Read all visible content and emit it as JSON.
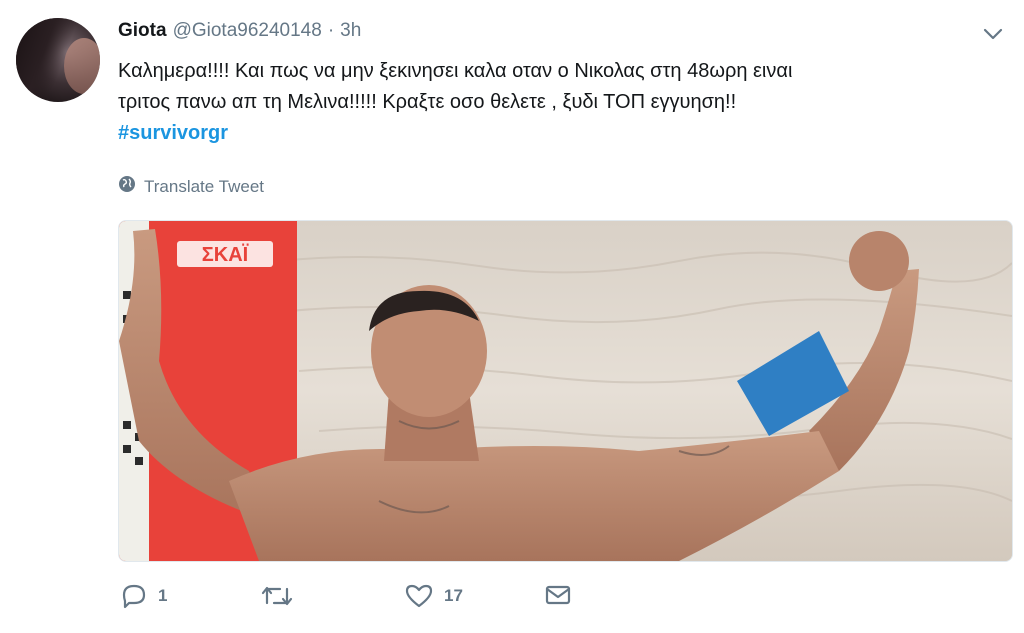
{
  "tweet": {
    "display_name": "Giota",
    "handle": "@Giota96240148",
    "separator": "·",
    "time": "3h",
    "text_line1": "Καλημερα!!!! Και πως να μην ξεκινησει καλα οταν ο Νικολας στη 48ωρη ειναι",
    "text_line2": "τριτος πανω απ τη Μελινα!!!!! Κραξτε οσο θελετε , ξυδι ΤΟΠ εγγυηση!!",
    "hashtag": "#survivorgr",
    "translate_label": "Translate Tweet",
    "media_logo_text": "ΣΚΑΪ"
  },
  "actions": {
    "reply_count": "1",
    "retweet_count": "",
    "like_count": "17"
  },
  "icons": {
    "caret": "chevron-down-icon",
    "globe": "globe-icon",
    "reply": "reply-icon",
    "retweet": "retweet-icon",
    "like": "heart-icon",
    "message": "envelope-icon"
  },
  "colors": {
    "link": "#1b95e0",
    "muted": "#657786",
    "text": "#14171a",
    "logo_red": "#e8423a",
    "wristband": "#2f7fc4"
  }
}
